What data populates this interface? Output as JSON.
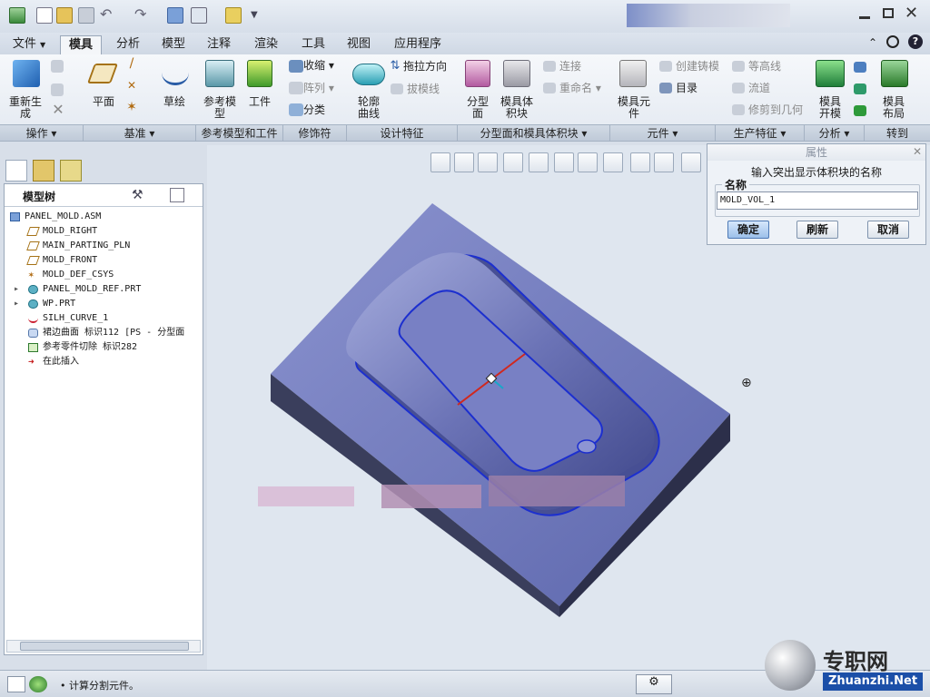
{
  "menu": {
    "file": "文件",
    "file_arrow": "▼"
  },
  "tabs": [
    "模具",
    "分析",
    "模型",
    "注释",
    "渲染",
    "工具",
    "视图",
    "应用程序"
  ],
  "ribbon": {
    "regen": "重新生\n成",
    "plane": "平面",
    "sketch": "草绘",
    "ref_model": "参考模\n型",
    "workpiece": "工件",
    "shrink": "收缩",
    "pattern": "阵列",
    "classify": "分类",
    "silhouette": "轮廓\n曲线",
    "drag_dir": "拖拉方向",
    "draft": "拔模线",
    "parting": "分型\n面",
    "mold_vol": "模具体\n积块",
    "connect": "连接",
    "rename": "重命名",
    "mold_comp": "模具元\n件",
    "create_cast": "创建铸模",
    "catalog": "目录",
    "contour": "等高线",
    "runner": "流道",
    "trim_geom": "修剪到几何",
    "mold_open": "模具\n开模",
    "mold_layout": "模具\n布局",
    "groups": [
      "操作",
      "基准",
      "参考模型和工件",
      "修饰符",
      "设计特征",
      "分型面和模具体积块",
      "元件",
      "生产特征",
      "分析",
      "转到"
    ]
  },
  "tree": {
    "title": "模型树",
    "items": [
      {
        "label": "PANEL_MOLD.ASM",
        "icon": "assembly-icon"
      },
      {
        "label": "MOLD_RIGHT",
        "icon": "datum-plane-icon"
      },
      {
        "label": "MAIN_PARTING_PLN",
        "icon": "datum-plane-icon"
      },
      {
        "label": "MOLD_FRONT",
        "icon": "datum-plane-icon"
      },
      {
        "label": "MOLD_DEF_CSYS",
        "icon": "csys-icon"
      },
      {
        "label": "PANEL_MOLD_REF.PRT",
        "icon": "part-icon"
      },
      {
        "label": "WP.PRT",
        "icon": "part-icon"
      },
      {
        "label": "SILH_CURVE_1",
        "icon": "curve-icon"
      },
      {
        "label": "裙边曲面 标识112 [PS - 分型面",
        "icon": "surface-icon"
      },
      {
        "label": "参考零件切除 标识282",
        "icon": "cut-icon"
      },
      {
        "label": "在此插入",
        "icon": "insert-arrow-icon"
      }
    ]
  },
  "dialog": {
    "title": "属性",
    "prompt": "输入突出显示体积块的名称",
    "name_label": "名称",
    "name_value": "MOLD_VOL_1",
    "ok": "确定",
    "refresh": "刷新",
    "cancel": "取消"
  },
  "status": {
    "message": "• 计算分割元件。"
  },
  "watermark": {
    "cn": "专职网",
    "en": "Zhuanzhi.Net"
  },
  "colors": {
    "model": "#6d77b8",
    "accent": "#1f4bb0"
  }
}
